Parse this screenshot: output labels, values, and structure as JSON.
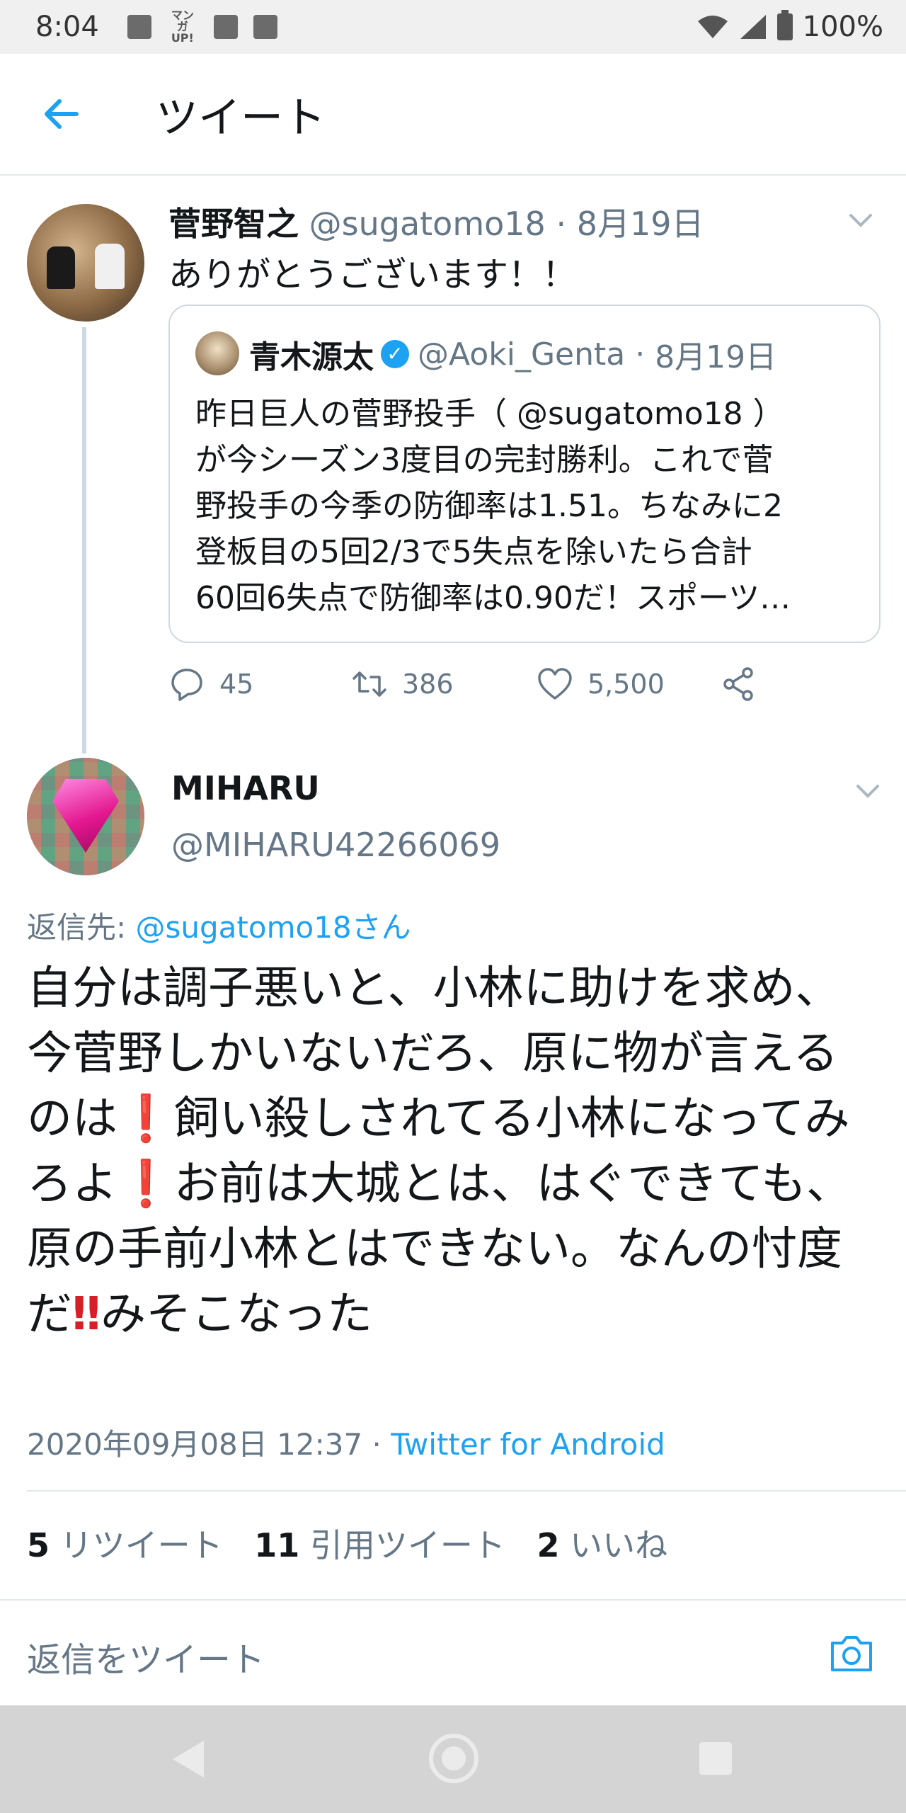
{
  "status_bar": {
    "time": "8:04",
    "manga_badge": "マンガ UP!",
    "battery": "100%"
  },
  "header": {
    "title": "ツイート"
  },
  "tweet1": {
    "name": "菅野智之",
    "handle": "@sugatomo18",
    "date": "8月19日",
    "text": "ありがとうございます！！",
    "quote": {
      "name": "青木源太",
      "verified_mark": "✓",
      "handle": "@Aoki_Genta",
      "date": "8月19日",
      "lines": [
        "昨日巨人の菅野投手（ @sugatomo18 ）",
        "が今シーズン3度目の完封勝利。これで菅",
        "野投手の今季の防御率は1.51。ちなみに2",
        "登板目の5回2/3で5失点を除いたら合計",
        "60回6失点で防御率は0.90だ！スポーツ…"
      ]
    },
    "actions": {
      "replies": "45",
      "retweets": "386",
      "likes": "5,500"
    }
  },
  "tweet2": {
    "name": "MIHARU",
    "handle": "@MIHARU42266069",
    "reply_to_label": "返信先: ",
    "reply_to_user": "@sugatomo18さん",
    "body_segments": [
      "自分は調子悪いと、小林に助けを求め、今菅野しかいないだろ、原に物が言えるのは",
      "❗",
      "飼い殺しされてる小林になってみろよ",
      "❗",
      "お前は大城とは、はぐできても、原の手前小林とはできない。なんの忖度だ",
      "‼",
      "みそこなった"
    ],
    "timestamp": "2020年09月08日 12:37 · ",
    "source": "Twitter for Android",
    "stats": {
      "retweets_count": "5",
      "retweets_label": "リツイート",
      "quotes_count": "11",
      "quotes_label": "引用ツイート",
      "likes_count": "2",
      "likes_label": "いいね"
    }
  },
  "reply_bar": {
    "placeholder": "返信をツイート"
  },
  "icons": [
    "back-arrow-icon",
    "caret-down-icon",
    "verified-badge-icon",
    "reply-icon",
    "retweet-icon",
    "like-icon",
    "share-icon",
    "camera-icon"
  ],
  "colors": {
    "accent": "#1da1f2",
    "secondary_text": "#657786",
    "exclamation": "#d61f26"
  }
}
